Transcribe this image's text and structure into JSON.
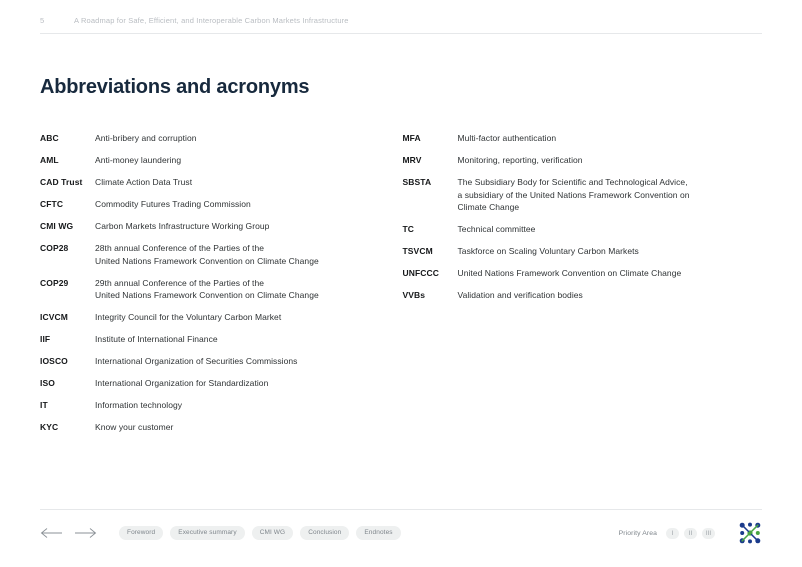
{
  "header": {
    "page_number": "5",
    "document_title": "A Roadmap for Safe, Efficient, and Interoperable Carbon Markets Infrastructure"
  },
  "section": {
    "title": "Abbreviations and acronyms"
  },
  "glossary": {
    "left_column": [
      {
        "term": "ABC",
        "definition_lines": [
          "Anti-bribery and corruption"
        ]
      },
      {
        "term": "AML",
        "definition_lines": [
          "Anti-money laundering"
        ]
      },
      {
        "term": "CAD Trust",
        "definition_lines": [
          "Climate Action Data Trust"
        ]
      },
      {
        "term": "CFTC",
        "definition_lines": [
          "Commodity Futures Trading Commission"
        ]
      },
      {
        "term": "CMI WG",
        "definition_lines": [
          "Carbon Markets Infrastructure Working Group"
        ]
      },
      {
        "term": "COP28",
        "definition_lines": [
          "28th annual Conference of the Parties of the",
          "United Nations Framework Convention on Climate Change"
        ]
      },
      {
        "term": "COP29",
        "definition_lines": [
          "29th annual Conference of the Parties of the",
          "United Nations Framework Convention on Climate Change"
        ]
      },
      {
        "term": "ICVCM",
        "definition_lines": [
          "Integrity Council for the Voluntary Carbon Market"
        ]
      },
      {
        "term": "IIF",
        "definition_lines": [
          "Institute of International Finance"
        ]
      },
      {
        "term": "IOSCO",
        "definition_lines": [
          "International Organization of Securities Commissions"
        ]
      },
      {
        "term": "ISO",
        "definition_lines": [
          "International Organization for Standardization"
        ]
      },
      {
        "term": "IT",
        "definition_lines": [
          "Information technology"
        ]
      },
      {
        "term": "KYC",
        "definition_lines": [
          "Know your customer"
        ]
      }
    ],
    "right_column": [
      {
        "term": "MFA",
        "definition_lines": [
          "Multi-factor authentication"
        ]
      },
      {
        "term": "MRV",
        "definition_lines": [
          "Monitoring, reporting, verification"
        ]
      },
      {
        "term": "SBSTA",
        "definition_lines": [
          "The Subsidiary Body for Scientific and Technological Advice,",
          "a subsidiary of the United Nations Framework Convention on",
          "Climate Change"
        ]
      },
      {
        "term": "TC",
        "definition_lines": [
          "Technical committee"
        ]
      },
      {
        "term": "TSVCM",
        "definition_lines": [
          "Taskforce on Scaling Voluntary Carbon Markets"
        ]
      },
      {
        "term": "UNFCCC",
        "definition_lines": [
          "United Nations Framework Convention on Climate Change"
        ]
      },
      {
        "term": "VVBs",
        "definition_lines": [
          "Validation and verification bodies"
        ]
      }
    ]
  },
  "footer": {
    "nav": {
      "previous_icon": "arrow-left-icon",
      "next_icon": "arrow-right-icon"
    },
    "section_links": [
      "Foreword",
      "Executive summary",
      "CMI WG",
      "Conclusion",
      "Endnotes"
    ],
    "priority_area": {
      "label": "Priority Area",
      "items": [
        "I",
        "II",
        "III"
      ]
    },
    "logo_name": "organization-logo"
  },
  "colors": {
    "title_navy": "#17293d",
    "header_gray": "#b9bdc2",
    "pill_background": "#eef0f0",
    "pill_text": "#7f868c",
    "logo_blue": "#1b3b8b",
    "logo_green": "#4aa543"
  }
}
